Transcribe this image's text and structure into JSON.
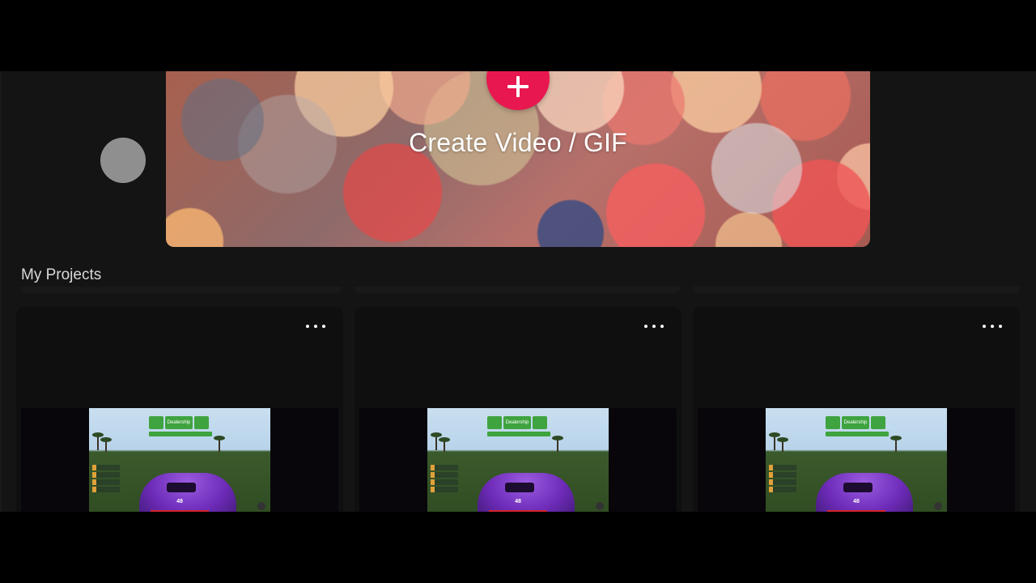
{
  "banner": {
    "create_label": "Create Video / GIF",
    "icon": "plus-icon",
    "accent": "#e8174f"
  },
  "section": {
    "title": "My Projects"
  },
  "projects": [
    {
      "menu_icon": "more-horizontal-icon",
      "thumb_button": "Dealership",
      "speed": "48"
    },
    {
      "menu_icon": "more-horizontal-icon",
      "thumb_button": "Dealership",
      "speed": "48"
    },
    {
      "menu_icon": "more-horizontal-icon",
      "thumb_button": "Dealership",
      "speed": "48"
    }
  ]
}
